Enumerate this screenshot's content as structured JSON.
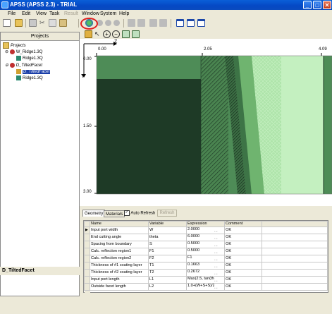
{
  "window": {
    "title": "APSS (APSS 2.3) - TRIAL",
    "min_glyph": "_",
    "max_glyph": "□",
    "close_glyph": "✕"
  },
  "menu": {
    "items": [
      "File",
      "Edit",
      "View",
      "Task",
      "Result",
      "Window",
      "System",
      "Help"
    ]
  },
  "left_panel": {
    "header": "Projects",
    "tree": [
      {
        "label": "Projects",
        "level": 0,
        "icon": "folder-icon",
        "italic": true
      },
      {
        "label": "W_Ridge1.3Q",
        "level": 1,
        "icon": "model-icon"
      },
      {
        "label": "Ridge1.3Q",
        "level": 2,
        "icon": "structure-icon"
      },
      {
        "label": "D_TiltedFacet",
        "level": 1,
        "icon": "model-icon",
        "italic": true
      },
      {
        "label": "D_TiltedFacet",
        "level": 2,
        "icon": "layout-icon",
        "italic": true,
        "selected": true
      },
      {
        "label": "Ridge1.3Q",
        "level": 2,
        "icon": "structure-icon"
      }
    ],
    "status": "D_TiltedFacet"
  },
  "canvas": {
    "x_axis_label": "Z",
    "y_axis_label": "Y",
    "x_ticks": [
      "0.00",
      "2.05",
      "4.09"
    ],
    "y_ticks": [
      "0.00",
      "1.50",
      "3.00"
    ],
    "colors": {
      "dark": "#1e3a26",
      "mid": "#4a8c56",
      "light": "#a8e0a8",
      "lighter": "#c4f0c0",
      "hatch": "#5c9060"
    }
  },
  "bottom": {
    "tabs": [
      "Geometry",
      "Materials"
    ],
    "auto_refresh_label": "Auto Refresh",
    "refresh_label": "Refresh",
    "columns": [
      "Name",
      "Variable",
      "Expression",
      "Comment"
    ],
    "rows": [
      {
        "name": "Input port width",
        "variable": "W",
        "expression": "2.0000",
        "comment": "OK",
        "current": true
      },
      {
        "name": "End cutting angle",
        "variable": "theta",
        "expression": "6.0000",
        "comment": "OK"
      },
      {
        "name": "Spacing from boundary",
        "variable": "S",
        "expression": "0.5000",
        "comment": "OK"
      },
      {
        "name": "Calc. reflection region1",
        "variable": "F1",
        "expression": "0.5000",
        "comment": "OK"
      },
      {
        "name": "Calc. reflection region2",
        "variable": "F2",
        "expression": "F1",
        "comment": "OK"
      },
      {
        "name": "Thickness of #1 coating layer",
        "variable": "T1",
        "expression": "0.1663",
        "comment": "OK"
      },
      {
        "name": "Thickness of #2 coating layer",
        "variable": "T2",
        "expression": "0.2672",
        "comment": "OK"
      },
      {
        "name": "Input port length",
        "variable": "L1",
        "expression": "Max(2.5, tan(thet",
        "comment": "OK"
      },
      {
        "name": "Outside facet length",
        "variable": "L2",
        "expression": "1.0+(W+S+S)/2*",
        "comment": "OK"
      }
    ],
    "dots": "..."
  }
}
